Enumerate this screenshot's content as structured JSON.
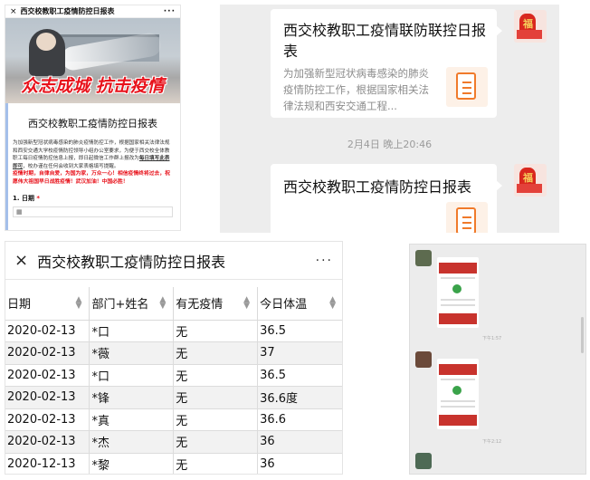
{
  "panel_a": {
    "close": "×",
    "title": "西交校教职工疫情防控日报表",
    "more": "···",
    "slogan": "众志成城 抗击疫情",
    "form_title": "西交校教职工疫情防控日报表",
    "desc_1": "为加强新型冠状病毒感染的肺炎疫情防控工作，根据国家相关法律法规和西安交通大学校疫情防控领导小组办公室要求，为便于西交校全体教职工每日疫情防控信息上报，即日起微信工作群上报改为",
    "desc_link": "每日填写此表即可",
    "desc_2": "，校办谨在任何会收到大家表格填写提醒。",
    "red_text": "疫情时期，自律自爱，为国为家，万众一心！相信疫情终将过去，祝愿伟大祖国早日战胜疫情！武汉加油！中国必胜！",
    "question": "1. 日期",
    "required_mark": "*"
  },
  "panel_b": {
    "message_1": {
      "title": "西交校教职工疫情联防联控日报表",
      "desc": "为加强新型冠状病毒感染的肺炎疫情防控工作，根据国家相关法律法规和西安交通工程..."
    },
    "timestamp": "2月4日 晚上20:46",
    "message_2": {
      "title": "西交校教职工疫情防控日报表"
    }
  },
  "panel_c": {
    "close": "×",
    "title": "西交校教职工疫情防控日报表",
    "more": "···",
    "columns": [
      "日期",
      "部门+姓名",
      "有无疫情",
      "今日体温"
    ],
    "rows": [
      [
        "2020-02-13",
        "*口",
        "无",
        "36.5"
      ],
      [
        "2020-02-13",
        "*薇",
        "无",
        "37"
      ],
      [
        "2020-02-13",
        "*口",
        "无",
        "36.5"
      ],
      [
        "2020-02-13",
        "*锋",
        "无",
        "36.6度"
      ],
      [
        "2020-02-13",
        "*真",
        "无",
        "36.6"
      ],
      [
        "2020-02-13",
        "*杰",
        "无",
        "36"
      ],
      [
        "2020-12-13",
        "*黎",
        "无",
        "36"
      ]
    ]
  },
  "panel_d": {
    "time_1": "下午1:57",
    "time_2": "下午2:12"
  }
}
